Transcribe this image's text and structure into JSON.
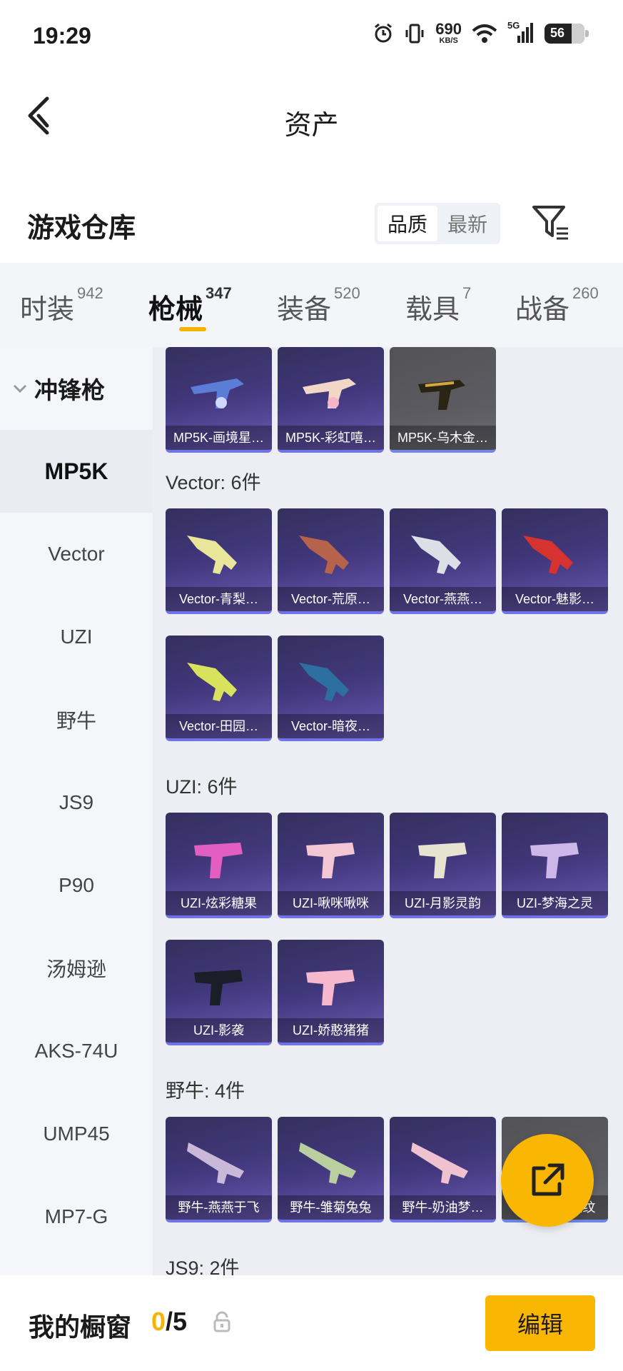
{
  "status_bar": {
    "time": "19:29",
    "net_speed_value": "690",
    "net_speed_unit": "KB/S",
    "signal_label": "5G",
    "battery": "56"
  },
  "nav": {
    "title": "资产"
  },
  "warehouse": {
    "title": "游戏仓库",
    "sort_options": [
      "品质",
      "最新"
    ],
    "active_sort": "品质"
  },
  "tabs": [
    {
      "label": "时装",
      "count": "942"
    },
    {
      "label": "枪械",
      "count": "347"
    },
    {
      "label": "装备",
      "count": "520"
    },
    {
      "label": "载具",
      "count": "7"
    },
    {
      "label": "战备",
      "count": "260"
    }
  ],
  "active_tab": "枪械",
  "sidebar": {
    "category": "冲锋枪",
    "items": [
      "MP5K",
      "Vector",
      "UZI",
      "野牛",
      "JS9",
      "P90",
      "汤姆逊",
      "AKS-74U",
      "UMP45",
      "MP7-G"
    ],
    "active": "MP5K"
  },
  "sections": [
    {
      "title": "",
      "items": [
        "MP5K-画境星…",
        "MP5K-彩虹嘻…",
        "MP5K-乌木金…"
      ]
    },
    {
      "title": "Vector: 6件",
      "items": [
        "Vector-青梨…",
        "Vector-荒原…",
        "Vector-燕燕…",
        "Vector-魅影…",
        "Vector-田园…",
        "Vector-暗夜…"
      ]
    },
    {
      "title": "UZI: 6件",
      "items": [
        "UZI-炫彩糖果",
        "UZI-啾咪啾咪",
        "UZI-月影灵韵",
        "UZI-梦海之灵",
        "UZI-影袭",
        "UZI-娇憨猪猪"
      ]
    },
    {
      "title": "野牛: 4件",
      "items": [
        "野牛-燕燕于飞",
        "野牛-雏菊兔兔",
        "野牛-奶油梦…",
        "野牛-乌木金纹"
      ]
    },
    {
      "title": "JS9: 2件",
      "items": []
    }
  ],
  "bottom_bar": {
    "title": "我的橱窗",
    "current": "0",
    "separator_total": "/5",
    "edit_label": "编辑"
  },
  "colors": {
    "accent": "#f9b704",
    "card_bg": "#3e3478",
    "card_border": "#6f73e6"
  },
  "icons": {
    "fab": "share-external-icon",
    "filter": "filter-icon",
    "back": "back-arrow-icon",
    "lock": "lock-icon"
  }
}
